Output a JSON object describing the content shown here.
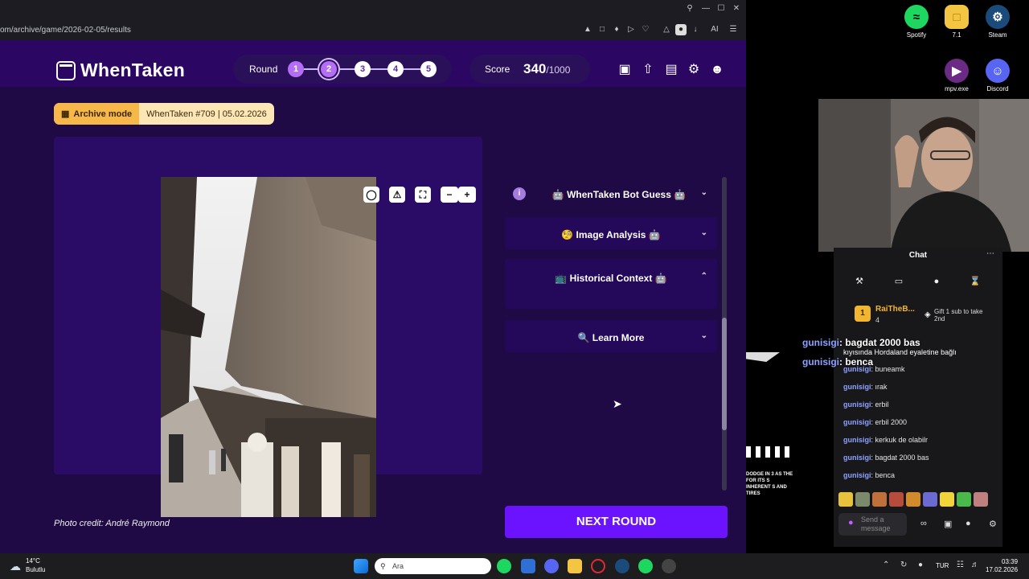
{
  "browser": {
    "url": "om/archive/game/2026-02-05/results",
    "ai_label": "AI"
  },
  "header": {
    "logo_text": "WhenTaken",
    "round_label": "Round",
    "rounds": [
      "1",
      "2",
      "3",
      "4",
      "5"
    ],
    "current_round": 2,
    "score_label": "Score",
    "score_value": "340",
    "score_max": "/1000"
  },
  "archive": {
    "mode_label": "Archive mode",
    "info": "WhenTaken #709 | 05.02.2026"
  },
  "photo": {
    "credit": "Photo credit: André Raymond"
  },
  "side_panel": {
    "sections": [
      {
        "label": "🤖 WhenTaken Bot Guess 🤖",
        "expanded": false
      },
      {
        "label": "🧐 Image Analysis 🤖",
        "expanded": false
      },
      {
        "label": "📺 Historical Context 🤖",
        "expanded": true
      },
      {
        "label": "🔍 Learn More",
        "expanded": false
      }
    ],
    "next_round": "NEXT ROUND"
  },
  "desktop": {
    "icons": [
      {
        "label": "Spotify",
        "color": "#1ed760"
      },
      {
        "label": "7.1",
        "color": "#f4c542"
      },
      {
        "label": "Steam",
        "color": "#1b4b7a"
      },
      {
        "label": "mpv.exe",
        "color": "#6b2a84"
      },
      {
        "label": "Discord",
        "color": "#5865f2"
      }
    ]
  },
  "chat": {
    "title": "Chat",
    "pinned_user": "RaiTheB...",
    "pinned_count": "4",
    "gift_text": "Gift 1 sub to take 2nd",
    "big_messages": [
      {
        "user": "gunisigi",
        "text": ": bagdat 2000 bas"
      },
      {
        "user": "gunisigi",
        "text": ": benca"
      }
    ],
    "partial_line": "kıyısında Hordaland eyaletine bağlı",
    "messages": [
      {
        "user": "gunisigi",
        "text": ": buneamk"
      },
      {
        "user": "gunisigi",
        "text": ": ırak"
      },
      {
        "user": "gunisigi",
        "text": ": erbil"
      },
      {
        "user": "gunisigi",
        "text": ": erbil 2000"
      },
      {
        "user": "gunisigi",
        "text": ": kerkuk de olabilr"
      },
      {
        "user": "gunisigi",
        "text": ": bagdat 2000 bas"
      },
      {
        "user": "gunisigi",
        "text": ": benca"
      }
    ],
    "send_placeholder": "Send a message"
  },
  "overlay": {
    "text": "DODGE IN 3 AS THE FOR ITS S INHERENT S AND TIRES"
  },
  "taskbar": {
    "temperature": "14°C",
    "weather": "Bulutlu",
    "search_placeholder": "Ara",
    "language": "TUR",
    "time": "03:39",
    "date": "17.02.2026"
  }
}
